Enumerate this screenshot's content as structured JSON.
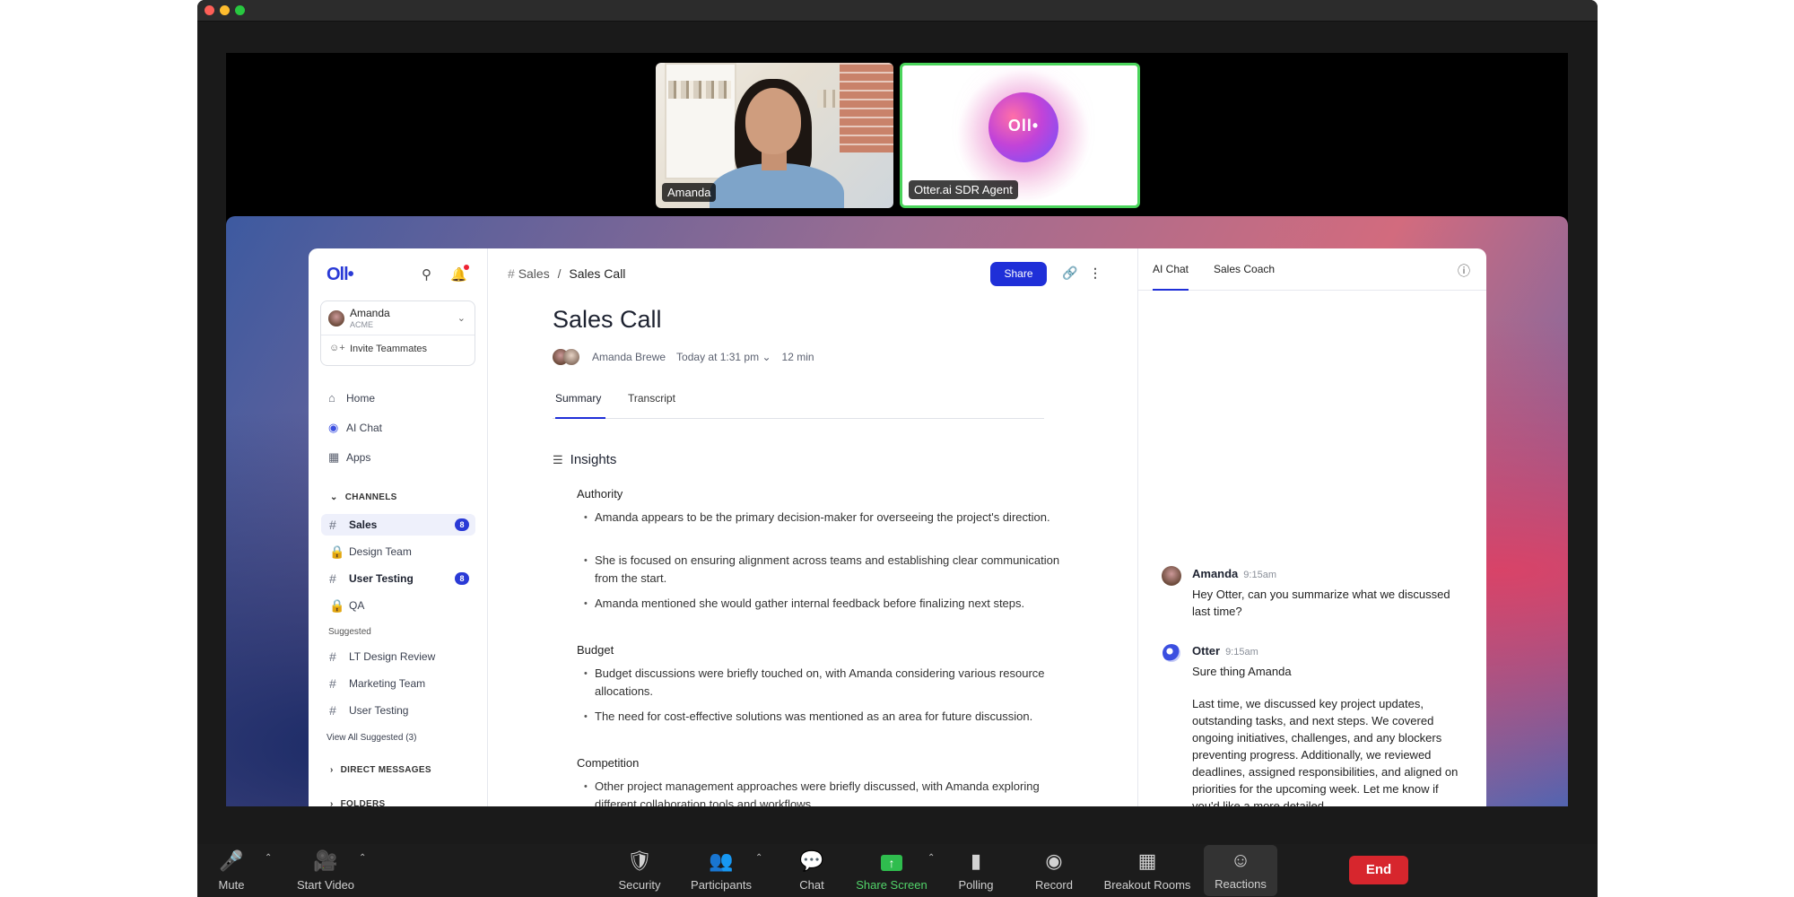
{
  "participants": [
    {
      "name": "Amanda"
    },
    {
      "name": "Otter.ai SDR Agent"
    }
  ],
  "app": {
    "logo": "Oll•",
    "account": {
      "name": "Amanda",
      "org": "ACME"
    },
    "invite_label": "Invite Teammates",
    "nav": [
      {
        "label": "Home",
        "icon": "home-icon"
      },
      {
        "label": "AI Chat",
        "icon": "ai-chat-icon"
      },
      {
        "label": "Apps",
        "icon": "apps-icon"
      }
    ],
    "channels_header": "CHANNELS",
    "channels": [
      {
        "label": "Sales",
        "icon": "hash-icon",
        "badge": "8"
      },
      {
        "label": "Design Team",
        "icon": "lock-icon"
      },
      {
        "label": "User Testing",
        "icon": "hash-icon",
        "badge": "8"
      },
      {
        "label": "QA",
        "icon": "lock-icon"
      }
    ],
    "suggested_header": "Suggested",
    "suggested": [
      {
        "label": "LT Design Review"
      },
      {
        "label": "Marketing Team"
      },
      {
        "label": "User Testing"
      }
    ],
    "view_all": "View All Suggested (3)",
    "direct_messages_header": "DIRECT MESSAGES",
    "folders_header": "FOLDERS"
  },
  "main": {
    "breadcrumb_parent": "Sales",
    "breadcrumb_sep": "/",
    "breadcrumb_current": "Sales Call",
    "share_label": "Share",
    "title": "Sales Call",
    "meta": {
      "author": "Amanda Brewe",
      "date": "Today at 1:31 pm",
      "duration": "12 min"
    },
    "tabs": [
      "Summary",
      "Transcript"
    ],
    "insights_title": "Insights",
    "sections": [
      {
        "title": "Authority",
        "bullets": [
          "Amanda appears to be the primary decision-maker for overseeing the project's direction.",
          "She is focused on ensuring alignment across teams and establishing clear communication from the start.",
          "Amanda mentioned she would gather internal feedback before finalizing next steps."
        ]
      },
      {
        "title": "Budget",
        "bullets": [
          "Budget discussions were briefly touched on, with Amanda considering various resource allocations.",
          "The need for cost-effective solutions was mentioned as an area for future discussion."
        ]
      },
      {
        "title": "Competition",
        "bullets": [
          "Other project management approaches were briefly discussed, with Amanda exploring different collaboration tools and workflows."
        ]
      }
    ]
  },
  "chat": {
    "tabs": [
      "AI Chat",
      "Sales Coach"
    ],
    "messages": [
      {
        "name": "Amanda",
        "time": "9:15am",
        "text": "Hey Otter, can you summarize what we discussed last time?"
      },
      {
        "name": "Otter",
        "time": "9:15am",
        "text": "Sure thing Amanda",
        "text2": "Last time, we discussed key project updates, outstanding tasks, and next steps. We covered ongoing initiatives, challenges, and any blockers preventing progress. Additionally, we reviewed deadlines, assigned responsibilities, and aligned on priorities for the upcoming week. Let me know if you'd like a more detailed"
      }
    ]
  },
  "toolbar": {
    "items": [
      {
        "label": "Mute",
        "icon": "microphone-icon"
      },
      {
        "label": "Start Video",
        "icon": "video-off-icon"
      },
      {
        "label": "Security",
        "icon": "shield-icon"
      },
      {
        "label": "Participants",
        "icon": "participants-icon"
      },
      {
        "label": "Chat",
        "icon": "chat-bubble-icon"
      },
      {
        "label": "Share Screen",
        "icon": "share-screen-icon"
      },
      {
        "label": "Polling",
        "icon": "bar-chart-icon"
      },
      {
        "label": "Record",
        "icon": "record-icon"
      },
      {
        "label": "Breakout Rooms",
        "icon": "grid-icon"
      },
      {
        "label": "Reactions",
        "icon": "smiley-icon"
      }
    ],
    "end_label": "End",
    "share_color": "#2fbd4e",
    "end_color": "#d7262d"
  }
}
